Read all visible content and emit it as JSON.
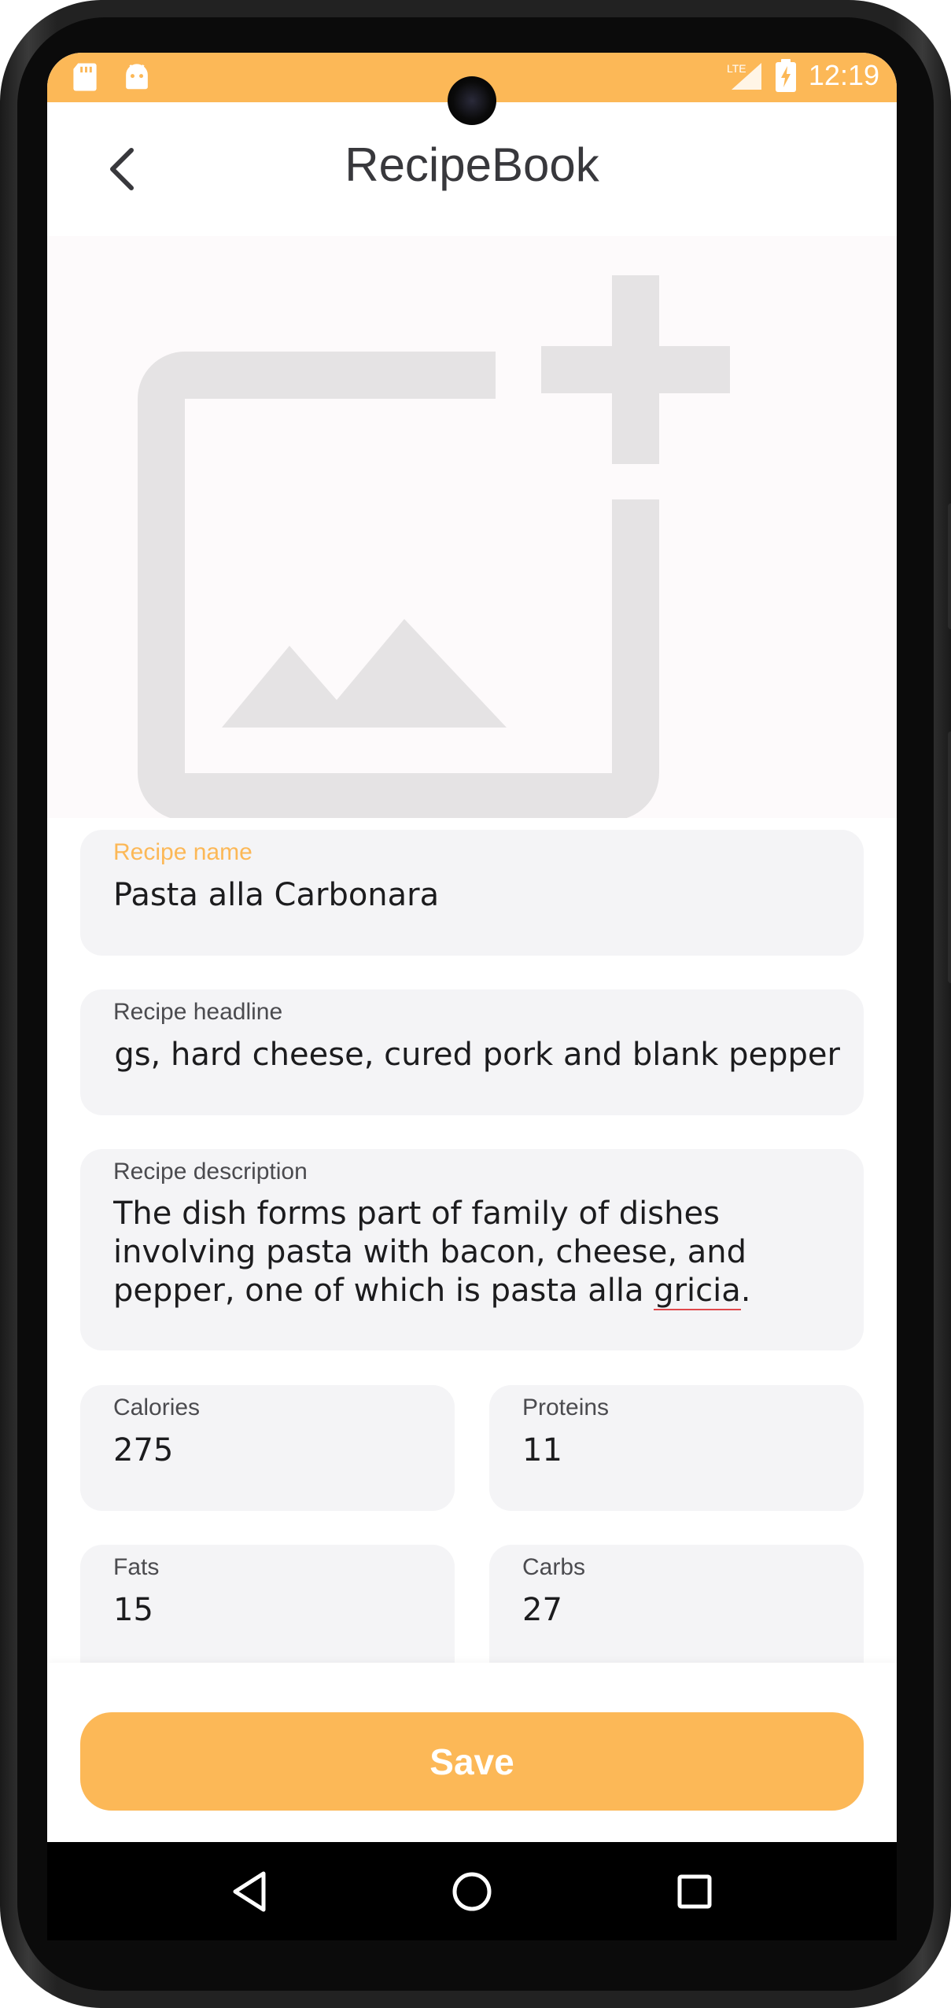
{
  "status_bar": {
    "time": "12:19",
    "network": "LTE",
    "left_icons": [
      "sd-card-icon",
      "android-icon"
    ],
    "right_icons": [
      "signal-icon",
      "battery-charging-icon"
    ]
  },
  "app_bar": {
    "title": "RecipeBook",
    "back_icon": "chevron-left-icon"
  },
  "image_picker": {
    "icon": "add-photo-icon"
  },
  "form": {
    "recipe_name": {
      "label": "Recipe name",
      "value": "Pasta alla Carbonara",
      "focused": true
    },
    "recipe_headline": {
      "label": "Recipe headline",
      "value": "eggs, hard cheese, cured pork and blank pepper"
    },
    "recipe_description": {
      "label": "Recipe description",
      "value_before": "The dish forms part of family of dishes involving pasta with bacon, cheese, and pepper, one of which is pasta alla ",
      "value_misspelled": "gricia",
      "value_after": "."
    },
    "calories": {
      "label": "Calories",
      "value": "275"
    },
    "proteins": {
      "label": "Proteins",
      "value": "11"
    },
    "fats": {
      "label": "Fats",
      "value": "15"
    },
    "carbs": {
      "label": "Carbs",
      "value": "27"
    }
  },
  "actions": {
    "save_label": "Save"
  },
  "nav_bar": {
    "buttons": [
      "back-triangle-icon",
      "home-circle-icon",
      "recents-square-icon"
    ]
  },
  "colors": {
    "accent": "#fcb857",
    "field_bg": "#f4f4f6",
    "placeholder_icon": "#e5e3e4",
    "spellcheck_underline": "#e0474b"
  }
}
